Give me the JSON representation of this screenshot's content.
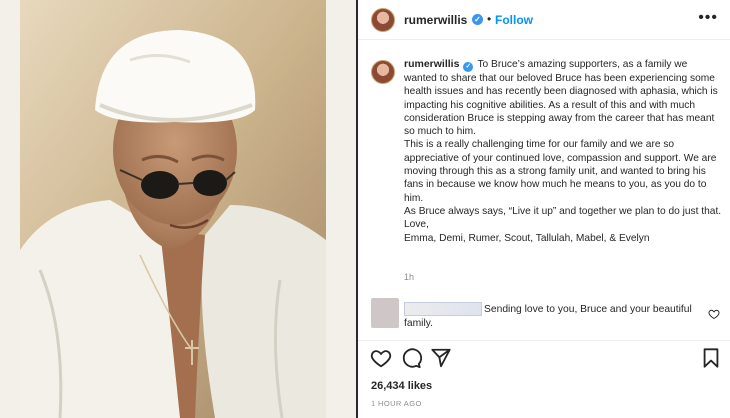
{
  "post": {
    "author": "rumerwillis",
    "verified_mark": "✓",
    "follow_label": "Follow",
    "more_label": "•••",
    "separator": "•",
    "caption_lines": [
      "To Bruce’s amazing supporters, as a family we wanted to share that our beloved Bruce has been experiencing some health issues and has recently been diagnosed with aphasia, which is impacting his cognitive abilities. As a result of this and with much consideration Bruce is stepping away from the career that has meant so much to him.",
      "This is a really challenging time for our family and we are so appreciative of your continued love, compassion and support. We are moving through this as a strong family unit, and wanted to bring his fans in because we know how much he means to you, as you do to him.",
      "As Bruce always says, “Live it up” and together we plan to do just that.",
      "Love,",
      "Emma, Demi, Rumer, Scout, Tallulah, Mabel, & Evelyn"
    ],
    "caption_time": "1h",
    "comment": {
      "text_line1": "Sending love to you, Bruce and your beautiful",
      "text_line2": "family."
    },
    "likes": "26,434 likes",
    "posted_ago": "1 HOUR AGO"
  },
  "icons": {
    "like": "heart-icon",
    "comment": "comment-icon",
    "share": "share-icon",
    "save": "bookmark-icon",
    "more": "more-icon"
  },
  "colors": {
    "accent": "#0095f6",
    "verified": "#3897f0",
    "muted": "#8e8e8e"
  }
}
